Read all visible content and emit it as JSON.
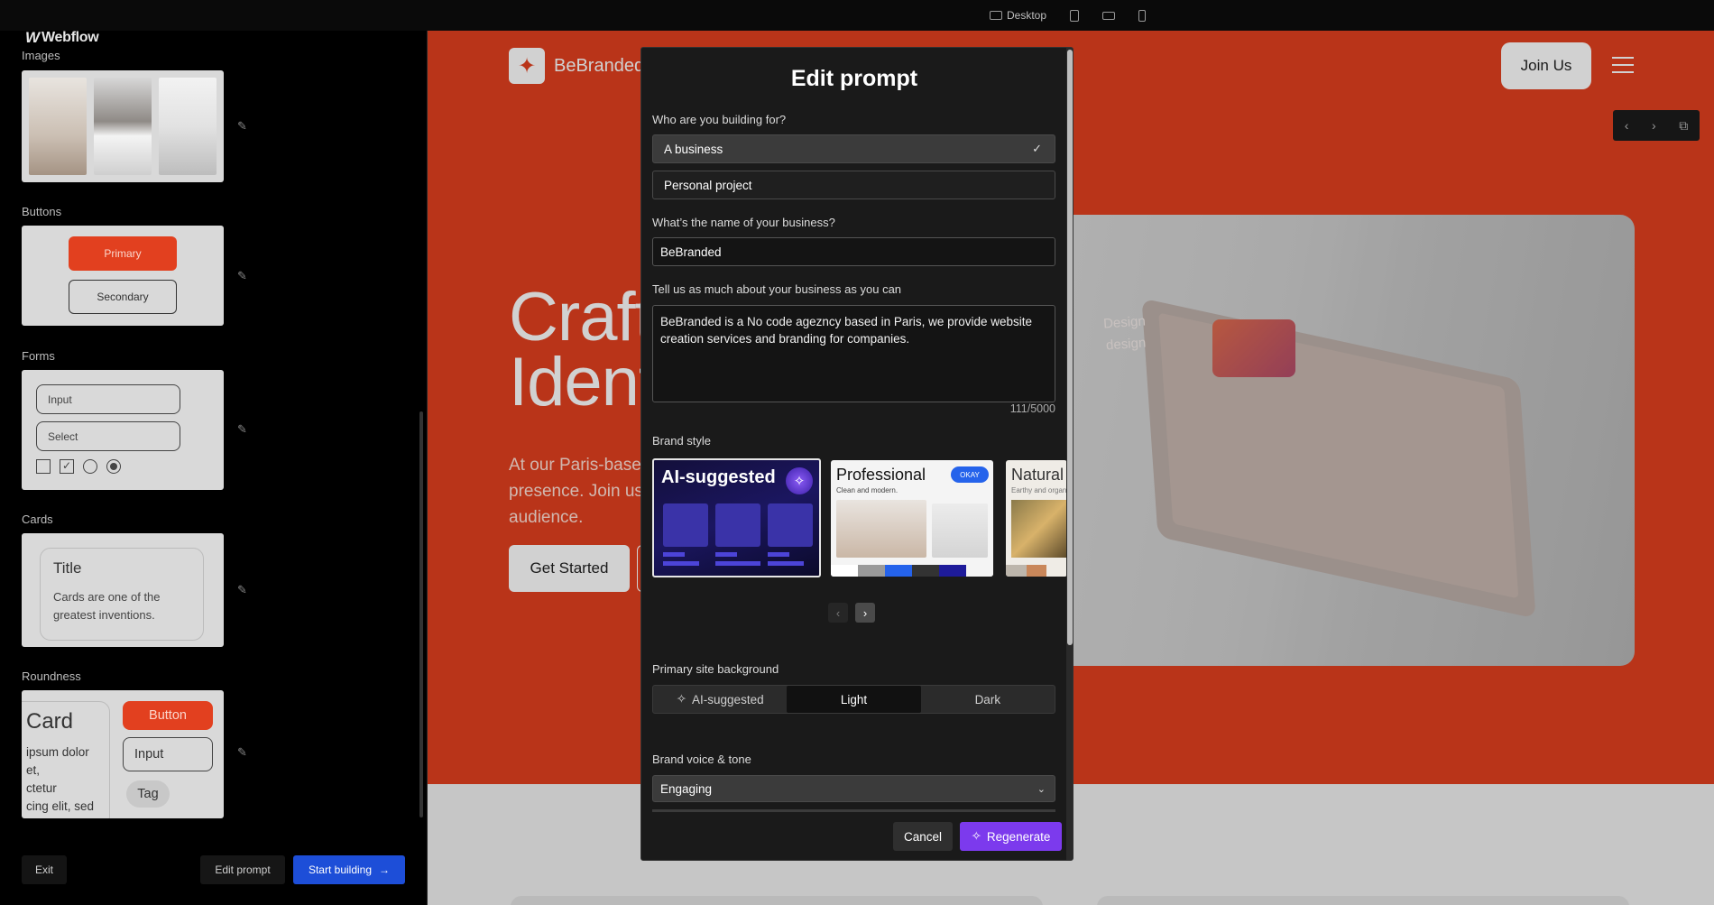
{
  "app": {
    "brand": "Webflow"
  },
  "topbar": {
    "devices": [
      {
        "name": "desktop",
        "label": "Desktop"
      },
      {
        "name": "tablet",
        "label": ""
      },
      {
        "name": "mobile-landscape",
        "label": ""
      },
      {
        "name": "mobile-portrait",
        "label": ""
      }
    ]
  },
  "left_panel": {
    "sections": {
      "images": "Images",
      "buttons": "Buttons",
      "forms": "Forms",
      "cards": "Cards",
      "roundness": "Roundness"
    },
    "buttons_preview": {
      "primary": "Primary",
      "secondary": "Secondary"
    },
    "forms_preview": {
      "input": "Input",
      "select": "Select"
    },
    "cards_preview": {
      "title": "Title",
      "body": "Cards are one of the greatest inventions."
    },
    "roundness_preview": {
      "card_title": "Card",
      "card_lines": [
        "ipsum dolor",
        "et,",
        "ctetur",
        "cing elit, sed"
      ],
      "button": "Button",
      "input": "Input",
      "tag": "Tag"
    },
    "footer": {
      "exit": "Exit",
      "edit_prompt": "Edit prompt",
      "start_building": "Start building"
    }
  },
  "preview": {
    "brand": "BeBranded",
    "join": "Join Us",
    "hero_title_lines": [
      "Craft",
      "Ident"
    ],
    "hero_sub_lines": [
      "At our Paris-based",
      "presence. Join us",
      "audience."
    ],
    "cta": "Get Started",
    "image_text_lines": [
      "Design",
      "design"
    ]
  },
  "modal": {
    "title": "Edit prompt",
    "q_for": "Who are you building for?",
    "options": [
      "A business",
      "Personal project"
    ],
    "selected_option": "A business",
    "q_name": "What’s the name of your business?",
    "name_value": "BeBranded",
    "q_about": "Tell us as much about your business as you can",
    "about_value": "BeBranded is a No code ageznсy based in Paris, we provide website creation services and branding for companies.",
    "about_count": "111/5000",
    "brand_style_label": "Brand style",
    "styles": [
      {
        "title": "AI-suggested",
        "subtitle": "",
        "badge": ""
      },
      {
        "title": "Professional",
        "subtitle": "Clean and modern.",
        "badge": "OKAY"
      },
      {
        "title": "Natural",
        "subtitle": "Earthy and organic",
        "badge": ""
      }
    ],
    "selected_style": "AI-suggested",
    "background_label": "Primary site background",
    "background_options": [
      "AI-suggested",
      "Light",
      "Dark"
    ],
    "background_selected": "Light",
    "voice_label": "Brand voice & tone",
    "voice_value": "Engaging",
    "cancel": "Cancel",
    "regenerate": "Regenerate"
  },
  "colors": {
    "accent_orange": "#e2401f",
    "accent_purple": "#7c3aed",
    "start_building_blue": "#1d4ed8",
    "panel_bg": "#000000",
    "modal_bg": "#1a1a1a"
  },
  "icons": [
    "webflow-logo-icon",
    "desktop-icon",
    "tablet-icon",
    "mobile-landscape-icon",
    "mobile-portrait-icon",
    "pencil-icon",
    "checkmark-icon",
    "chevron-down-icon",
    "sparkle-icon",
    "arrow-right-icon",
    "chevron-left-icon",
    "chevron-right-icon",
    "hamburger-icon",
    "expand-icon"
  ]
}
